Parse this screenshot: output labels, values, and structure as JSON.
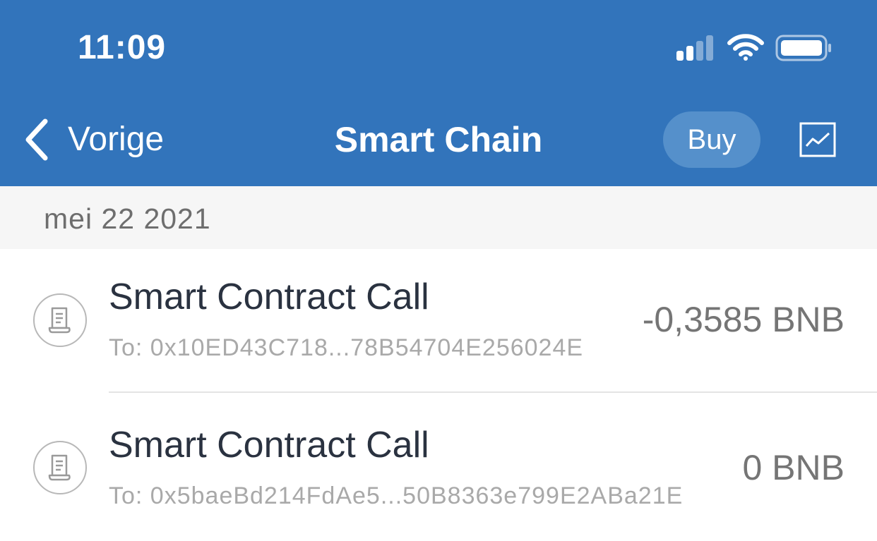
{
  "status_bar": {
    "time": "11:09",
    "signal_icon": "cellular-signal-icon",
    "wifi_icon": "wifi-icon",
    "battery_icon": "battery-icon"
  },
  "nav": {
    "back_label": "Vorige",
    "title": "Smart Chain",
    "buy_label": "Buy",
    "chart_icon": "price-chart-icon"
  },
  "colors": {
    "header_bg": "#3274bb",
    "buy_button_bg": "#5590cb",
    "section_bg": "#f6f6f6"
  },
  "transactions": {
    "date_header": "mei 22 2021",
    "items": [
      {
        "title": "Smart Contract Call",
        "to": "To: 0x10ED43C718...78B54704E256024E",
        "amount": "-0,3585 BNB",
        "icon": "receipt-icon"
      },
      {
        "title": "Smart Contract Call",
        "to": "To: 0x5baeBd214FdAe5...50B8363e799E2ABa21E",
        "amount": "0 BNB",
        "icon": "receipt-icon"
      }
    ]
  }
}
